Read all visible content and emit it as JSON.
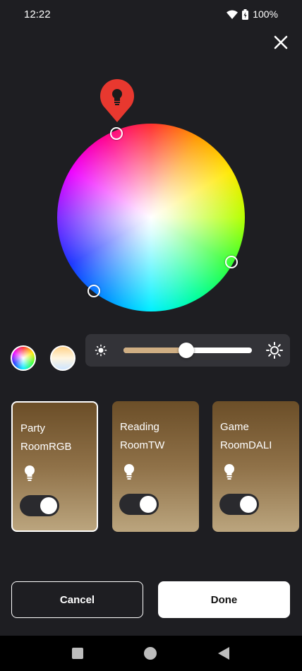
{
  "status_bar": {
    "time": "12:22",
    "battery": "100%",
    "icons": [
      "wifi-icon",
      "battery-icon"
    ]
  },
  "close_icon": "close-icon",
  "color_wheel": {
    "pin_icon": "lightbulb-icon",
    "pin_color": "#e8382f",
    "handles": 3
  },
  "modes": [
    {
      "name": "rgb",
      "icon": "color-wheel-icon"
    },
    {
      "name": "tunable-white",
      "icon": "white-temperature-icon"
    }
  ],
  "brightness": {
    "value_percent": 49,
    "min_icon": "sun-small-icon",
    "max_icon": "sun-large-icon",
    "fill_color": "#cfae83"
  },
  "cards": [
    {
      "name": "Party\nRoomRGB",
      "selected": true,
      "on": true,
      "icon": "lightbulb-icon"
    },
    {
      "name": "Reading\nRoomTW",
      "selected": false,
      "on": true,
      "icon": "lightbulb-icon"
    },
    {
      "name": "Game\nRoomDALI",
      "selected": false,
      "on": true,
      "icon": "lightbulb-icon"
    }
  ],
  "buttons": {
    "cancel_label": "Cancel",
    "done_label": "Done"
  },
  "nav": {
    "icons": [
      "recents-icon",
      "home-icon",
      "back-icon"
    ]
  }
}
